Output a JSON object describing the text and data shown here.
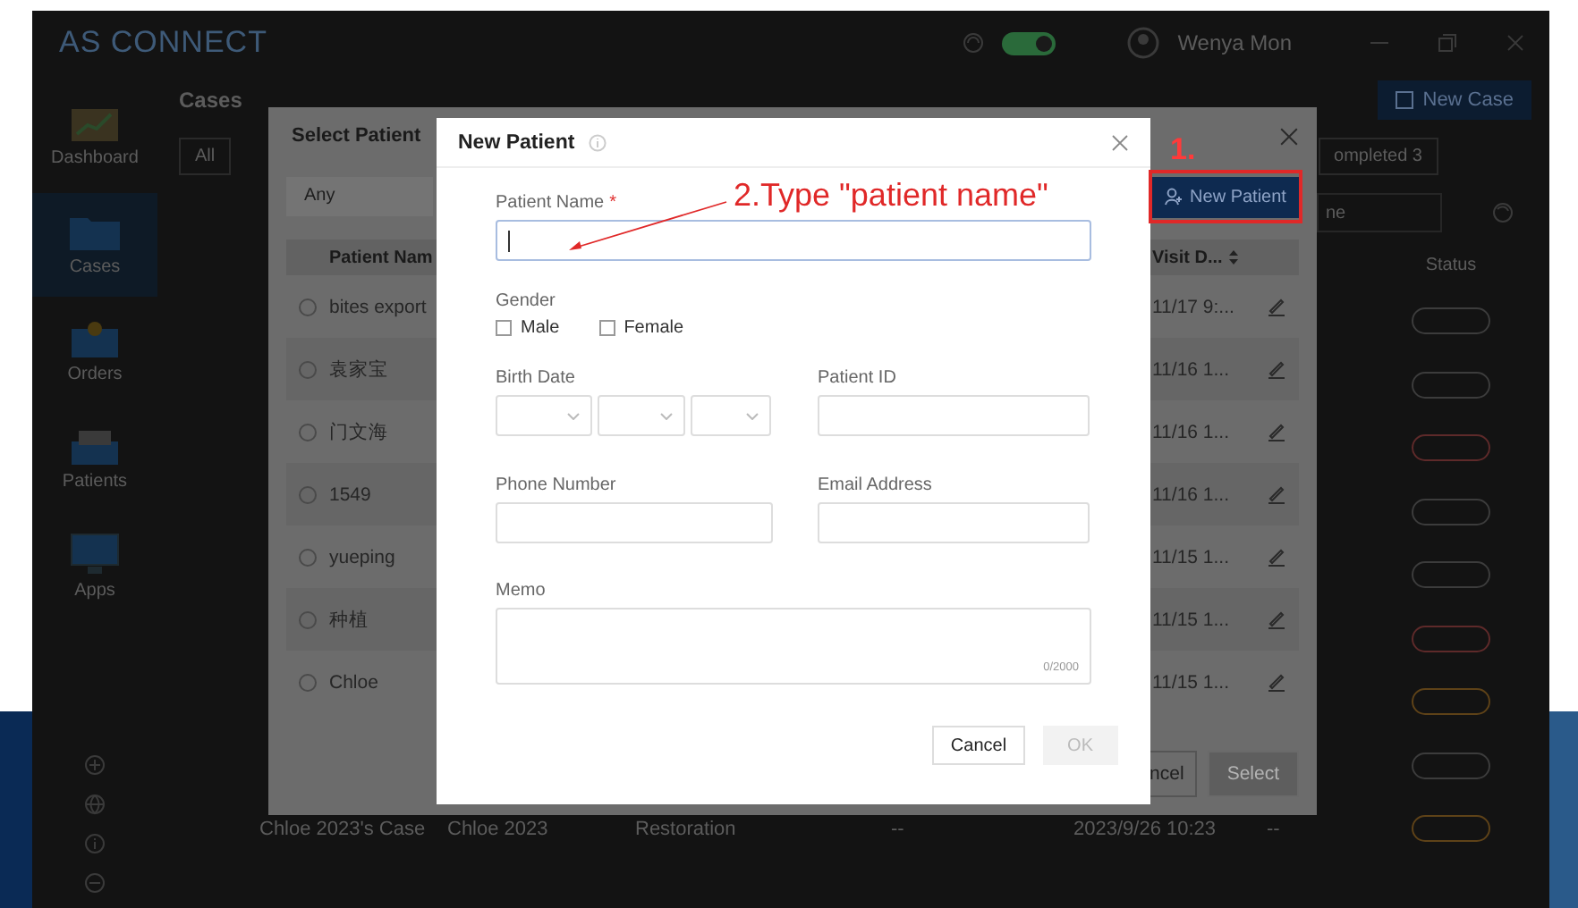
{
  "window": {
    "title": "AS CONNECT",
    "sync_on": true,
    "user": "Wenya Mon"
  },
  "sidebar": {
    "items": [
      {
        "label": "Dashboard",
        "kind": "chart",
        "selected": false
      },
      {
        "label": "Cases",
        "kind": "folder",
        "selected": true
      },
      {
        "label": "Orders",
        "kind": "inbox",
        "selected": false
      },
      {
        "label": "Patients",
        "kind": "tray",
        "selected": false
      },
      {
        "label": "Apps",
        "kind": "monitor",
        "selected": false
      }
    ]
  },
  "cases": {
    "title": "Cases",
    "new_button": "New Case",
    "filter_all": "All",
    "filter_completed": "ompleted 3",
    "search_fragment": "ne",
    "status_header": "Status",
    "status_pills": [
      {
        "color": "#3c3c3c"
      },
      {
        "color": "#3c3c3c"
      },
      {
        "color": "#5e2a2a"
      },
      {
        "color": "#3c3c3c"
      },
      {
        "color": "#3c3c3c"
      },
      {
        "color": "#5e2a2a"
      },
      {
        "color": "#5e4218"
      },
      {
        "color": "#3c3c3c"
      },
      {
        "color": "#5e4218"
      }
    ],
    "bottom_row": [
      "Chloe 2023's Case",
      "Chloe 2023",
      "Restoration",
      "--",
      "2023/9/26 10:23",
      "--"
    ]
  },
  "select_patient": {
    "title": "Select Patient",
    "filter": "Any",
    "new_patient_button": "New Patient",
    "columns": [
      "Patient Nam",
      "Visit D..."
    ],
    "rows": [
      {
        "name": "bites export",
        "visit": "11/17 9:...",
        "selected": false
      },
      {
        "name": "袁家宝",
        "visit": "11/16 1...",
        "selected": false
      },
      {
        "name": "门文海",
        "visit": "11/16 1...",
        "selected": false
      },
      {
        "name": "1549",
        "visit": "11/16 1...",
        "selected": false
      },
      {
        "name": "yueping",
        "visit": "11/15 1...",
        "selected": false
      },
      {
        "name": "种植",
        "visit": "11/15 1...",
        "selected": false
      },
      {
        "name": "Chloe",
        "visit": "11/15 1...",
        "selected": false
      }
    ],
    "buttons": [
      {
        "label": "ncel",
        "disabled": false
      },
      {
        "label": "Select",
        "disabled": true
      }
    ]
  },
  "new_patient": {
    "title": "New Patient",
    "patient_name": {
      "label": "Patient Name",
      "required_mark": "*",
      "focused": true
    },
    "gender": {
      "label": "Gender",
      "options": [
        {
          "label": "Male",
          "checked": false
        },
        {
          "label": "Female",
          "checked": false
        }
      ]
    },
    "birth_date": {
      "label": "Birth Date"
    },
    "patient_id": {
      "label": "Patient ID"
    },
    "phone": {
      "label": "Phone Number"
    },
    "email": {
      "label": "Email Address"
    },
    "memo": {
      "label": "Memo",
      "counter": "0/2000"
    },
    "buttons": [
      {
        "label": "Cancel",
        "disabled": false
      },
      {
        "label": "OK",
        "disabled": true
      }
    ]
  },
  "annotations": [
    {
      "text": "1."
    },
    {
      "text": "2.Type \"patient name\""
    }
  ]
}
